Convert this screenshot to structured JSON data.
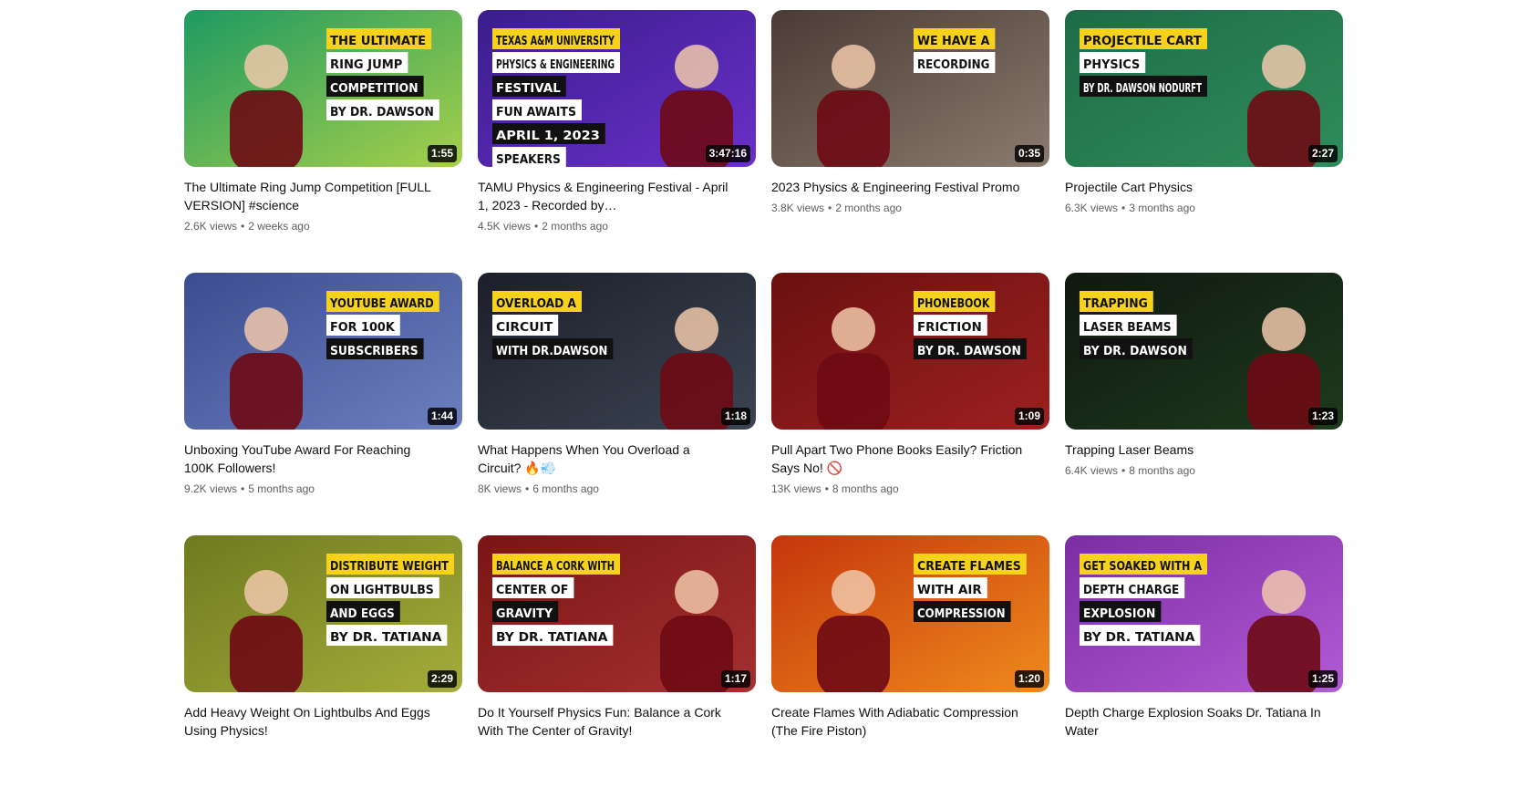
{
  "videos": [
    {
      "title": "The Ultimate Ring Jump Competition [FULL VERSION] #science",
      "views": "2.6K views",
      "age": "2 weeks ago",
      "duration": "1:55",
      "thumb_lines": [
        "THE ULTIMATE",
        "RING JUMP",
        "COMPETITION",
        "BY DR. DAWSON"
      ],
      "colors": [
        "#1d9a62",
        "#a7d04a"
      ]
    },
    {
      "title": "TAMU Physics & Engineering Festival - April 1, 2023 - Recorded by…",
      "views": "4.5K views",
      "age": "2 months ago",
      "duration": "3:47:16",
      "thumb_lines": [
        "TEXAS A&M UNIVERSITY",
        "PHYSICS & ENGINEERING",
        "FESTIVAL",
        "FUN AWAITS",
        "APRIL 1, 2023",
        "SPEAKERS"
      ],
      "colors": [
        "#3a1d8c",
        "#6a30c9"
      ]
    },
    {
      "title": "2023 Physics & Engineering Festival Promo",
      "views": "3.8K views",
      "age": "2 months ago",
      "duration": "0:35",
      "thumb_lines": [
        "WE HAVE A",
        "RECORDING"
      ],
      "colors": [
        "#4a3b35",
        "#8a7a6e"
      ]
    },
    {
      "title": "Projectile Cart Physics",
      "views": "6.3K views",
      "age": "3 months ago",
      "duration": "2:27",
      "thumb_lines": [
        "PROJECTILE CART",
        "PHYSICS",
        "BY DR. DAWSON NODURFT"
      ],
      "colors": [
        "#1e6b46",
        "#2f8d5c"
      ]
    },
    {
      "title": "Unboxing YouTube Award For Reaching 100K Followers!",
      "views": "9.2K views",
      "age": "5 months ago",
      "duration": "1:44",
      "thumb_lines": [
        "YOUTUBE AWARD",
        "FOR 100K",
        "SUBSCRIBERS"
      ],
      "colors": [
        "#3c4d8f",
        "#6c7fbf"
      ]
    },
    {
      "title": "What Happens When You Overload a Circuit? 🔥💨",
      "views": "8K views",
      "age": "6 months ago",
      "duration": "1:18",
      "thumb_lines": [
        "OVERLOAD A",
        "CIRCUIT",
        "WITH DR.DAWSON"
      ],
      "colors": [
        "#1c1f2a",
        "#3c4452"
      ]
    },
    {
      "title": "Pull Apart Two Phone Books Easily? Friction Says No! 🚫",
      "views": "13K views",
      "age": "8 months ago",
      "duration": "1:09",
      "thumb_lines": [
        "PHONEBOOK",
        "FRICTION",
        "BY DR. DAWSON"
      ],
      "colors": [
        "#6b1010",
        "#9d2020"
      ]
    },
    {
      "title": "Trapping Laser Beams",
      "views": "6.4K views",
      "age": "8 months ago",
      "duration": "1:23",
      "thumb_lines": [
        "TRAPPING",
        "LASER BEAMS",
        "BY DR. DAWSON"
      ],
      "colors": [
        "#101810",
        "#1e3a1e"
      ]
    },
    {
      "title": "Add Heavy Weight On Lightbulbs And Eggs Using Physics!",
      "views": "",
      "age": "",
      "duration": "2:29",
      "thumb_lines": [
        "DISTRIBUTE WEIGHT",
        "ON LIGHTBULBS",
        "AND EGGS",
        "BY DR. TATIANA"
      ],
      "colors": [
        "#6f7a1f",
        "#a4ad3a"
      ]
    },
    {
      "title": "Do It Yourself Physics Fun: Balance a Cork With The Center of Gravity!",
      "views": "",
      "age": "",
      "duration": "1:17",
      "thumb_lines": [
        "BALANCE A CORK WITH",
        "CENTER OF",
        "GRAVITY",
        "BY DR. TATIANA"
      ],
      "colors": [
        "#7a1515",
        "#a53030"
      ]
    },
    {
      "title": "Create Flames With Adiabatic Compression (The Fire Piston)",
      "views": "",
      "age": "",
      "duration": "1:20",
      "thumb_lines": [
        "CREATE FLAMES",
        "WITH AIR",
        "COMPRESSION"
      ],
      "colors": [
        "#c4360c",
        "#f08a1d"
      ]
    },
    {
      "title": "Depth Charge Explosion Soaks Dr. Tatiana In Water",
      "views": "",
      "age": "",
      "duration": "1:25",
      "thumb_lines": [
        "GET SOAKED WITH A",
        "DEPTH CHARGE",
        "EXPLOSION",
        "BY DR. TATIANA"
      ],
      "colors": [
        "#7a2ea3",
        "#b45ad6"
      ]
    }
  ]
}
